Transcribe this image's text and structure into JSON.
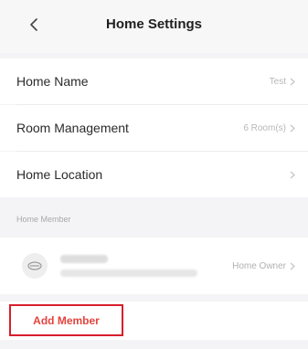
{
  "header": {
    "title": "Home Settings",
    "back_icon": "chevron-left-icon"
  },
  "settings": {
    "rows": [
      {
        "label": "Home Name",
        "value": "Test"
      },
      {
        "label": "Room Management",
        "value": "6 Room(s)"
      },
      {
        "label": "Home Location",
        "value": ""
      }
    ]
  },
  "members": {
    "section_title": "Home Member",
    "items": [
      {
        "name": "",
        "account": "",
        "role": "Home Owner",
        "avatar_icon": "user-avatar-icon"
      }
    ]
  },
  "actions": {
    "add_member_label": "Add Member",
    "accent_color": "#e2443d"
  }
}
